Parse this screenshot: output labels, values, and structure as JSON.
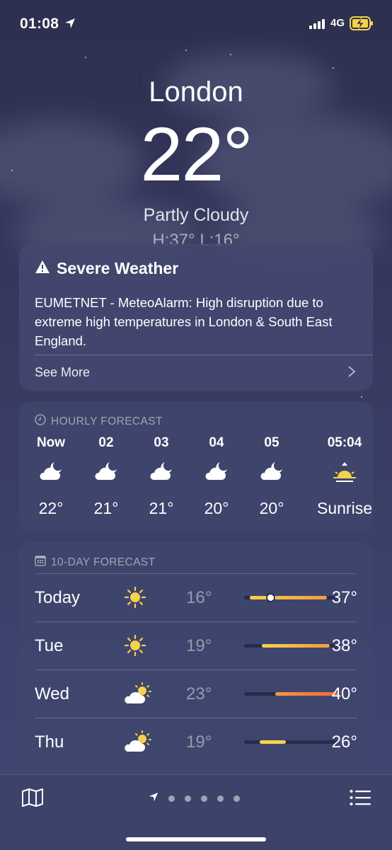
{
  "status": {
    "time": "01:08",
    "network": "4G"
  },
  "header": {
    "city": "London",
    "temperature": "22°",
    "condition": "Partly Cloudy",
    "high_low": "H:37°  L:16°"
  },
  "severe": {
    "title": "Severe Weather",
    "body": "EUMETNET - MeteoAlarm: High disruption due to extreme high temperatures in London & South East England.",
    "more": "See More"
  },
  "hourly": {
    "header": "HOURLY FORECAST",
    "items": [
      {
        "hour": "Now",
        "temp": "22°",
        "icon": "cloud-moon-icon"
      },
      {
        "hour": "02",
        "temp": "21°",
        "icon": "cloud-moon-icon"
      },
      {
        "hour": "03",
        "temp": "21°",
        "icon": "cloud-moon-icon"
      },
      {
        "hour": "04",
        "temp": "20°",
        "icon": "cloud-moon-icon"
      },
      {
        "hour": "05",
        "temp": "20°",
        "icon": "cloud-moon-icon"
      },
      {
        "hour": "05:04",
        "temp": "Sunrise",
        "icon": "sunrise-icon"
      }
    ]
  },
  "tenday": {
    "header": "10-DAY FORECAST",
    "rows": [
      {
        "day": "Today",
        "low": "16°",
        "high": "37°",
        "icon": "sun-icon",
        "range_start": 0.06,
        "range_end": 0.89,
        "current": 0.28
      },
      {
        "day": "Tue",
        "low": "19°",
        "high": "38°",
        "icon": "sun-icon",
        "range_start": 0.19,
        "range_end": 0.92
      },
      {
        "day": "Wed",
        "low": "23°",
        "high": "40°",
        "icon": "cloud-sun-icon",
        "range_start": 0.33,
        "range_end": 1.0
      },
      {
        "day": "Thu",
        "low": "19°",
        "high": "26°",
        "icon": "cloud-sun-icon",
        "range_start": 0.17,
        "range_end": 0.45
      }
    ]
  },
  "colors": {
    "yellow": "#f6d24a",
    "orange": "#f59a3c",
    "red": "#ee6a3a"
  }
}
